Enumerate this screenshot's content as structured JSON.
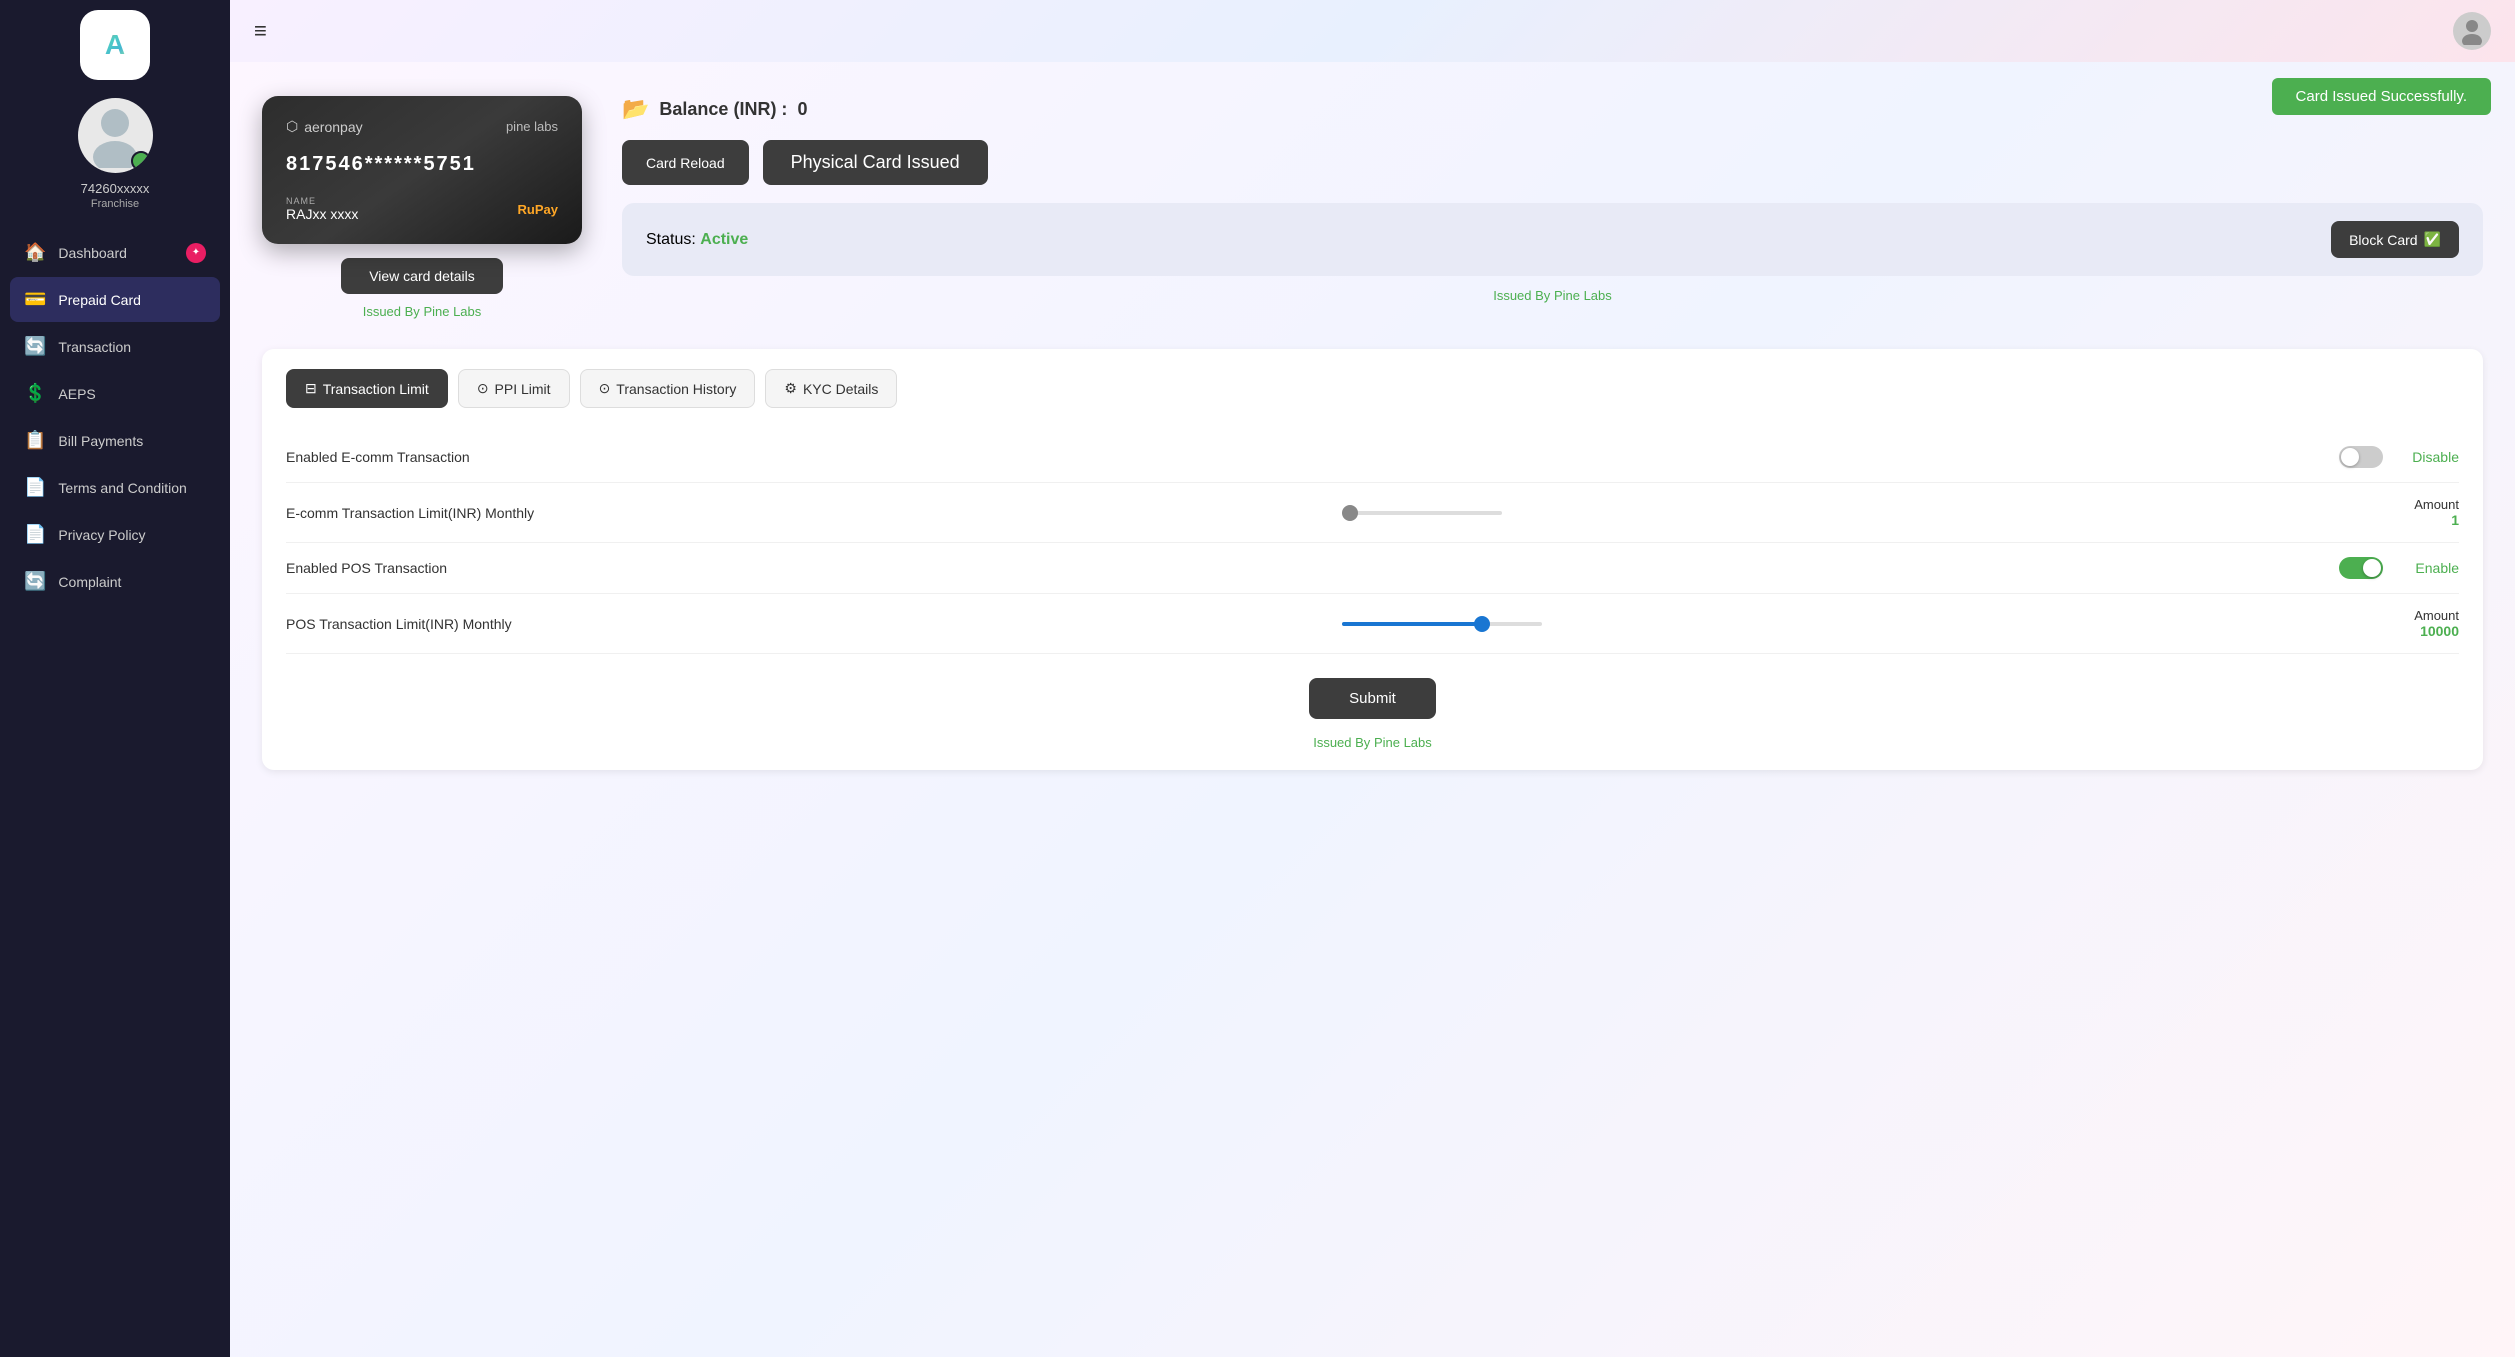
{
  "sidebar": {
    "logo": "A",
    "user_id": "74260xxxxx",
    "role": "Franchise",
    "nav_items": [
      {
        "id": "dashboard",
        "label": "Dashboard",
        "icon": "🏠",
        "badge": "★",
        "active": false
      },
      {
        "id": "prepaid-card",
        "label": "Prepaid Card",
        "icon": "💳",
        "active": true
      },
      {
        "id": "transaction",
        "label": "Transaction",
        "icon": "🔄",
        "active": false
      },
      {
        "id": "aeps",
        "label": "AEPS",
        "icon": "💲",
        "active": false
      },
      {
        "id": "bill-payments",
        "label": "Bill Payments",
        "icon": "📋",
        "active": false
      },
      {
        "id": "terms",
        "label": "Terms and Condition",
        "icon": "📄",
        "active": false
      },
      {
        "id": "privacy",
        "label": "Privacy Policy",
        "icon": "📄",
        "active": false
      },
      {
        "id": "complaint",
        "label": "Complaint",
        "icon": "🔄",
        "active": false
      }
    ]
  },
  "header": {
    "menu_icon": "≡",
    "profile_icon": "👤"
  },
  "success_banner": "Card Issued Successfully.",
  "card": {
    "brand": "aeronpay",
    "issuer": "pine labs",
    "number": "817546******5751",
    "name_label": "NAME",
    "name": "RAJxx xxxx",
    "payment_network": "RuPay",
    "view_btn": "View card details",
    "issued_by_label": "Issued By",
    "issued_by": "Pine Labs"
  },
  "card_info": {
    "balance_label": "Balance (INR) :",
    "balance_amount": "0",
    "reload_btn": "Card Reload",
    "physical_btn": "Physical Card Issued",
    "status_label": "Status:",
    "status_value": "Active",
    "block_btn": "Block Card",
    "issued_by_label": "Issued By",
    "issued_by": "Pine Labs"
  },
  "tabs": [
    {
      "id": "transaction-limit",
      "label": "Transaction Limit",
      "icon": "⊟",
      "active": true
    },
    {
      "id": "ppi-limit",
      "label": "PPI Limit",
      "icon": "⊙",
      "active": false
    },
    {
      "id": "transaction-history",
      "label": "Transaction History",
      "icon": "⊙",
      "active": false
    },
    {
      "id": "kyc-details",
      "label": "KYC Details",
      "icon": "⚙",
      "active": false
    }
  ],
  "transaction_limits": {
    "ecomm_toggle_label": "Enabled E-comm Transaction",
    "ecomm_toggle_state": "off",
    "ecomm_status": "Disable",
    "ecomm_limit_label": "E-comm Transaction Limit(INR) Monthly",
    "ecomm_amount_label": "Amount",
    "ecomm_amount": "1",
    "ecomm_slider_pct": 0,
    "pos_toggle_label": "Enabled POS Transaction",
    "pos_toggle_state": "on",
    "pos_status": "Enable",
    "pos_limit_label": "POS Transaction Limit(INR) Monthly",
    "pos_amount_label": "Amount",
    "pos_amount": "10000",
    "pos_slider_pct": 70,
    "submit_btn": "Submit",
    "issued_by_label": "Issued By",
    "issued_by": "Pine Labs"
  },
  "colors": {
    "active_green": "#4caf50",
    "dark_btn": "#3d3d3d",
    "blue_slider": "#1976d2",
    "sidebar_bg": "#1a1a2e",
    "sidebar_active": "#2d2d5e"
  }
}
